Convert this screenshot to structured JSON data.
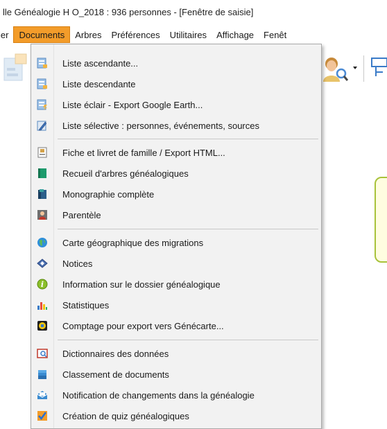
{
  "window": {
    "title": "lle Généalogie H O_2018 : 936 personnes - [Fenêtre de saisie]"
  },
  "menubar": {
    "items": [
      {
        "label": "ier"
      },
      {
        "label": "Documents"
      },
      {
        "label": "Arbres"
      },
      {
        "label": "Préférences"
      },
      {
        "label": "Utilitaires"
      },
      {
        "label": "Affichage"
      },
      {
        "label": "Fenêt"
      }
    ],
    "active_color": "#f39c2a"
  },
  "toolbar": {
    "icons": [
      "document-tree-icon",
      "person-search-icon",
      "dropdown-arrow-icon",
      "network-icon"
    ]
  },
  "documents_menu": {
    "items": [
      {
        "label": "Liste ascendante...",
        "icon": "list-up-icon"
      },
      {
        "label": "Liste descendante",
        "icon": "list-down-icon"
      },
      {
        "label": "Liste éclair - Export Google Earth...",
        "icon": "list-lightning-icon"
      },
      {
        "label": "Liste sélective : personnes, événements, sources",
        "icon": "pencil-list-icon"
      },
      {
        "label": "Fiche et livret de famille / Export HTML...",
        "icon": "family-sheet-icon"
      },
      {
        "label": "Recueil d'arbres généalogiques",
        "icon": "green-book-icon"
      },
      {
        "label": "Monographie complète",
        "icon": "blue-book-icon"
      },
      {
        "label": "Parentèle",
        "icon": "portrait-icon"
      },
      {
        "label": "Carte géographique des migrations",
        "icon": "globe-icon"
      },
      {
        "label": "Notices",
        "icon": "notice-icon"
      },
      {
        "label": "Information sur le dossier généalogique",
        "icon": "info-icon"
      },
      {
        "label": "Statistiques",
        "icon": "statistics-icon"
      },
      {
        "label": "Comptage pour export vers Génécarte...",
        "icon": "map-count-icon"
      },
      {
        "label": "Dictionnaires des données",
        "icon": "dictionary-icon"
      },
      {
        "label": "Classement de documents",
        "icon": "folder-stack-icon"
      },
      {
        "label": "Notification de changements dans la généalogie",
        "icon": "mail-icon"
      },
      {
        "label": "Création de quiz généalogiques",
        "icon": "checkmark-icon"
      }
    ]
  }
}
